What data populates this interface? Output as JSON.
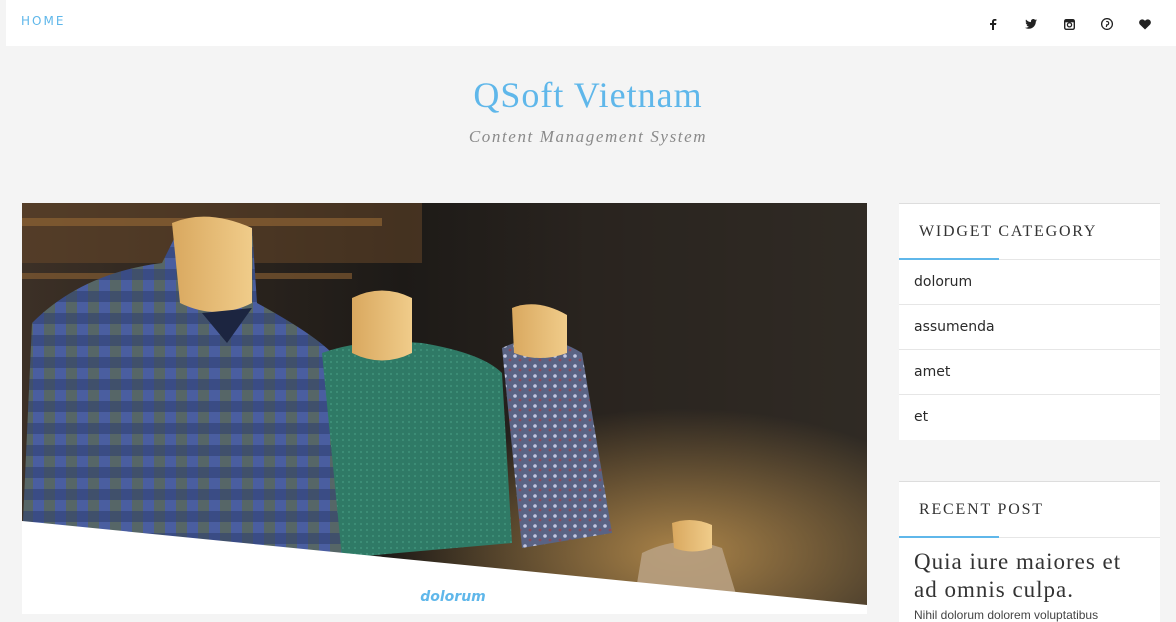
{
  "nav": {
    "home_label": "HOME"
  },
  "social": [
    "facebook-icon",
    "twitter-icon",
    "instagram-icon",
    "pinterest-icon",
    "heart-icon"
  ],
  "site": {
    "title": "QSoft Vietnam",
    "subtitle": "Content Management System"
  },
  "post": {
    "category": "dolorum"
  },
  "widget_category": {
    "title": "WIDGET CATEGORY",
    "items": [
      "dolorum",
      "assumenda",
      "amet",
      "et"
    ]
  },
  "recent_post": {
    "title": "RECENT POST",
    "post_title": "Quia iure maiores et ad omnis culpa.",
    "snippet": "Nihil dolorum dolorem voluptatibus"
  },
  "colors": {
    "accent": "#5fb7ea",
    "background": "#f4f4f4"
  }
}
